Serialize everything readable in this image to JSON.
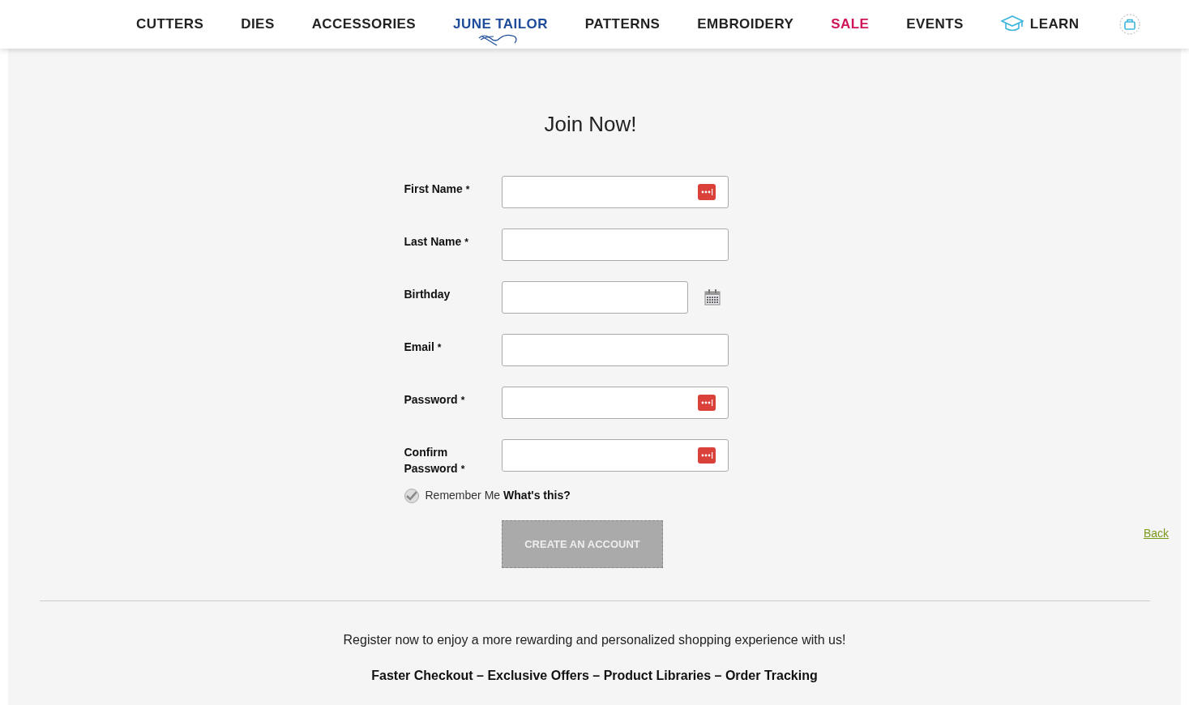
{
  "nav": [
    {
      "label": "CUTTERS",
      "kind": "plain"
    },
    {
      "label": "DIES",
      "kind": "plain"
    },
    {
      "label": "ACCESSORIES",
      "kind": "plain"
    },
    {
      "label": "JUNE TAILOR",
      "kind": "brand"
    },
    {
      "label": "PATTERNS",
      "kind": "plain"
    },
    {
      "label": "EMBROIDERY",
      "kind": "plain"
    },
    {
      "label": "SALE",
      "kind": "sale"
    },
    {
      "label": "EVENTS",
      "kind": "plain"
    },
    {
      "label": "LEARN",
      "kind": "learn"
    }
  ],
  "title": "Join Now!",
  "fields": [
    {
      "label": "First Name",
      "required": "*",
      "kind": "text",
      "autofill_icon": true
    },
    {
      "label": "Last Name",
      "required": "*",
      "kind": "text",
      "autofill_icon": false
    },
    {
      "label": "Birthday",
      "kind": "date",
      "autofill_icon": false
    },
    {
      "label": "Email",
      "required": "*",
      "kind": "text",
      "autofill_icon": false
    },
    {
      "label": "Password",
      "required": "*",
      "kind": "password",
      "autofill_icon": true
    },
    {
      "label": "Confirm Password",
      "required": "*",
      "kind": "password",
      "autofill_icon": true
    }
  ],
  "remember": {
    "label": "Remember Me",
    "checked": true,
    "help_link": "What's this?"
  },
  "submit": {
    "label": "CREATE AN ACCOUNT",
    "disabled": true
  },
  "back_link": "Back",
  "promo": "Register now to enjoy a more rewarding and personalized shopping experience with us!",
  "benefits": "Faster Checkout – Exclusive Offers – Product Libraries – Order Tracking"
}
